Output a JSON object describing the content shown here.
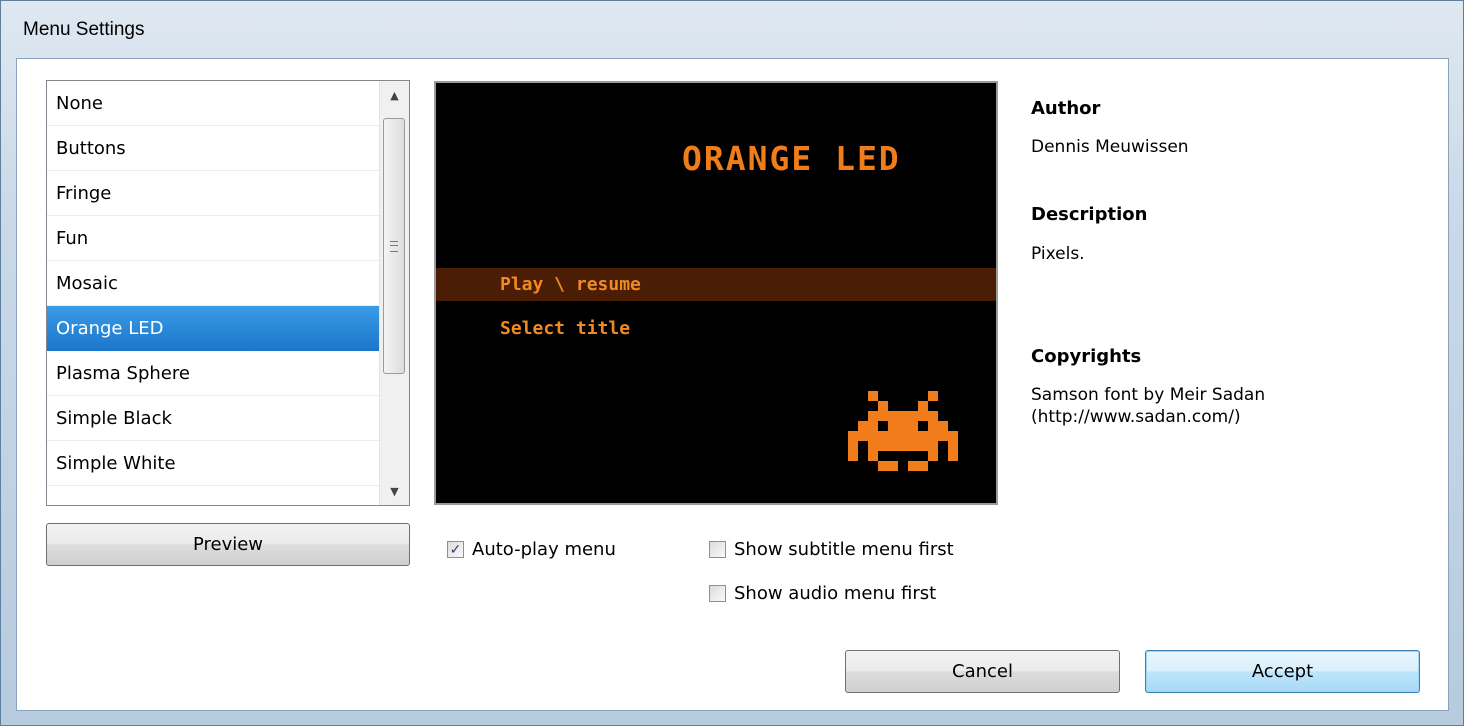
{
  "window": {
    "title": "Menu Settings"
  },
  "menu_list": {
    "items": [
      "None",
      "Buttons",
      "Fringe",
      "Fun",
      "Mosaic",
      "Orange LED",
      "Plasma Sphere",
      "Simple Black",
      "Simple White"
    ],
    "selected": "Orange LED"
  },
  "preview_button": "Preview",
  "preview_screen": {
    "title": "ORANGE LED",
    "items": [
      "Play \\ resume",
      "Select title"
    ]
  },
  "options": {
    "auto_play": {
      "label": "Auto-play menu",
      "checked": true
    },
    "subtitle_first": {
      "label": "Show subtitle menu first",
      "checked": false
    },
    "audio_first": {
      "label": "Show audio menu first",
      "checked": false
    }
  },
  "info": {
    "author_label": "Author",
    "author": "Dennis Meuwissen",
    "description_label": "Description",
    "description": "Pixels.",
    "copyrights_label": "Copyrights",
    "copyrights_line1": "Samson font by Meir Sadan",
    "copyrights_line2": "(http://www.sadan.com/)"
  },
  "buttons": {
    "cancel": "Cancel",
    "accept": "Accept"
  },
  "colors": {
    "selection": "#1c77cc",
    "preview_accent": "#f07d1a",
    "preview_bar": "#4a1d04"
  }
}
